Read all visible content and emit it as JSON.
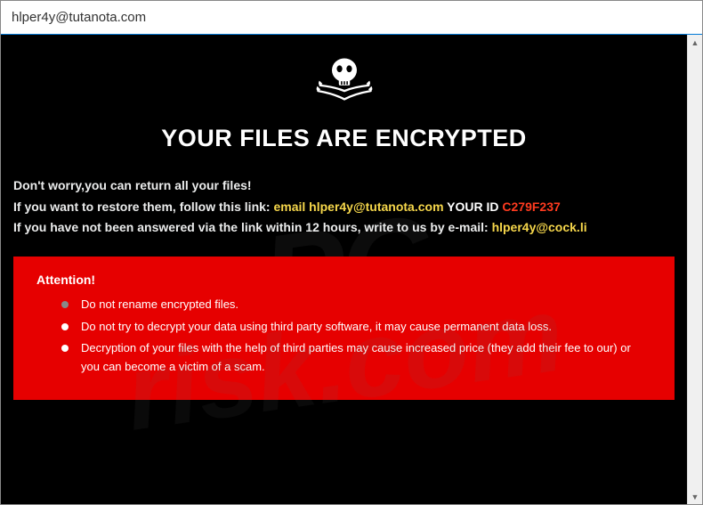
{
  "titlebar": {
    "title": "hlper4y@tutanota.com"
  },
  "heading": "YOUR FILES ARE ENCRYPTED",
  "lines": {
    "dont_worry": "Don't worry,you can return all your files!",
    "restore_prefix": "If you want to restore them, follow this link: ",
    "restore_email_label": "email ",
    "restore_email": "hlper4y@tutanota.com",
    "your_id_label": "  YOUR ID ",
    "your_id_value": "C279F237",
    "not_answered_prefix": "If you have not been answered via the link within 12 hours, write to us by e-mail: ",
    "not_answered_email": "hlper4y@cock.li"
  },
  "attention": {
    "title": "Attention!",
    "items": [
      "Do not rename encrypted files.",
      "Do not try to decrypt your data using third party software, it may cause permanent data loss.",
      "Decryption of your files with the help of third parties may cause increased price (they add their fee to our) or you can become a victim of a scam."
    ]
  },
  "scroll": {
    "up": "▲",
    "down": "▼"
  }
}
